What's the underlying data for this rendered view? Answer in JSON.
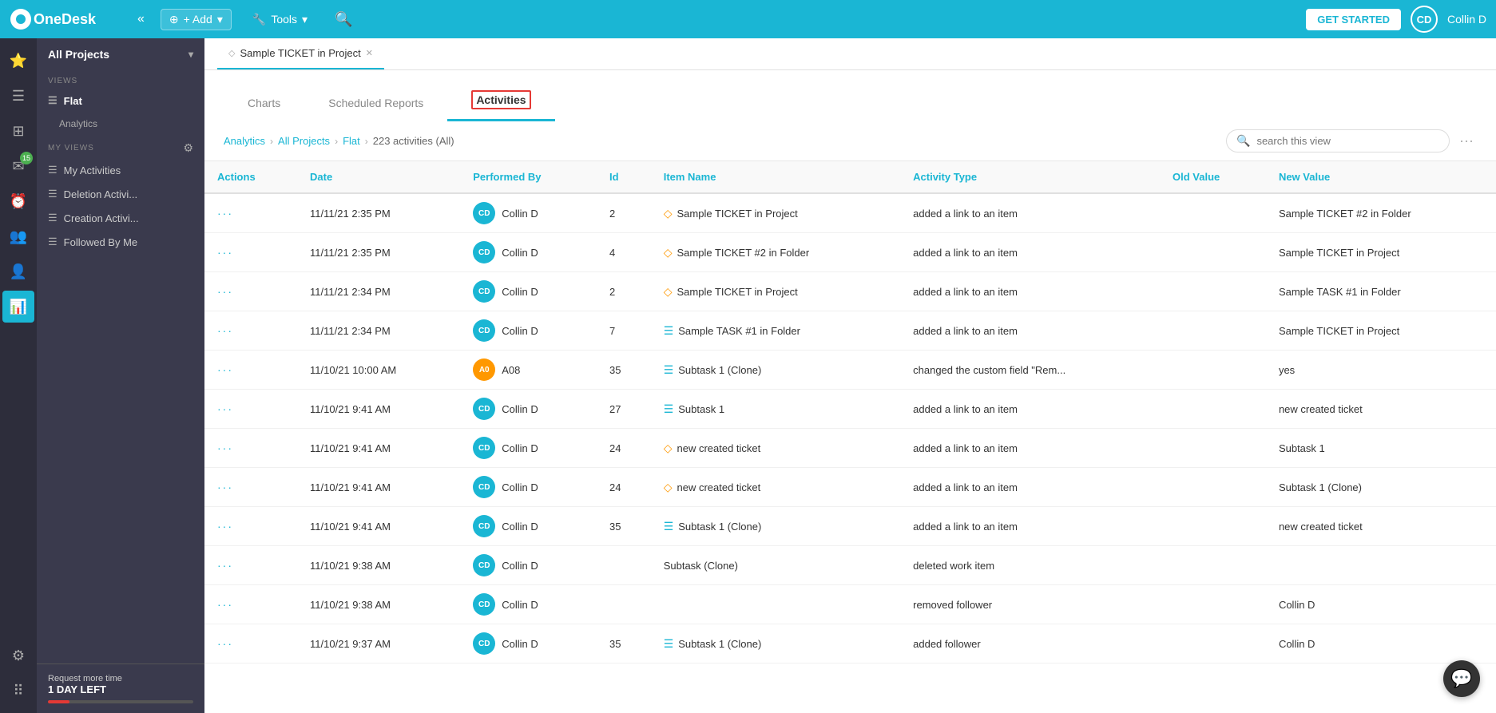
{
  "topbar": {
    "logo": "OneDesk",
    "collapse_btn": "«",
    "add_label": "+ Add",
    "add_dropdown": "▾",
    "tools_label": "Tools",
    "tools_dropdown": "▾",
    "get_started_label": "GET STARTED",
    "user_initials": "CD",
    "user_name": "Collin D"
  },
  "tab_bar": {
    "tabs": [
      {
        "label": "Sample TICKET in Project",
        "icon": "◇",
        "active": true,
        "closable": true
      }
    ]
  },
  "inner_tabs": {
    "tabs": [
      {
        "label": "Charts",
        "active": false
      },
      {
        "label": "Scheduled Reports",
        "active": false
      },
      {
        "label": "Activities",
        "active": true
      }
    ]
  },
  "breadcrumb": {
    "items": [
      "Analytics",
      "All Projects",
      "Flat"
    ],
    "current": "223 activities (All)"
  },
  "search": {
    "placeholder": "search this view"
  },
  "nav_sidebar": {
    "project_label": "All Projects",
    "views_label": "VIEWS",
    "flat_label": "Flat",
    "analytics_label": "Analytics",
    "my_views_label": "MY VIEWS",
    "my_views_items": [
      "My Activities",
      "Deletion Activi...",
      "Creation Activi...",
      "Followed By Me"
    ],
    "trial_label": "Request more time",
    "trial_days": "1 DAY LEFT"
  },
  "icon_sidebar": {
    "items": [
      {
        "icon": "★",
        "name": "favorites-icon",
        "active": false
      },
      {
        "icon": "☰",
        "name": "list-icon",
        "active": false
      },
      {
        "icon": "◻",
        "name": "board-icon",
        "active": false
      },
      {
        "icon": "✉",
        "name": "messages-icon",
        "active": false,
        "badge": "15"
      },
      {
        "icon": "⏰",
        "name": "timers-icon",
        "active": false
      },
      {
        "icon": "👥",
        "name": "users-icon",
        "active": false
      },
      {
        "icon": "👤",
        "name": "customers-icon",
        "active": false
      },
      {
        "icon": "📊",
        "name": "analytics-icon",
        "active": true
      }
    ],
    "bottom_items": [
      {
        "icon": "⚙",
        "name": "settings-icon",
        "active": false
      },
      {
        "icon": "⠿",
        "name": "apps-icon",
        "active": false
      }
    ]
  },
  "table": {
    "columns": [
      "Actions",
      "Date",
      "Performed By",
      "Id",
      "Item Name",
      "Activity Type",
      "Old Value",
      "New Value"
    ],
    "rows": [
      {
        "actions": "···",
        "date": "11/11/21 2:35 PM",
        "performed_by": "Collin D",
        "performed_by_initials": "CD",
        "performed_by_color": "blue",
        "id": "2",
        "item_name": "Sample TICKET in Project",
        "item_type": "ticket",
        "activity_type": "added a link to an item",
        "old_value": "",
        "new_value": "Sample TICKET #2 in Folder"
      },
      {
        "actions": "···",
        "date": "11/11/21 2:35 PM",
        "performed_by": "Collin D",
        "performed_by_initials": "CD",
        "performed_by_color": "blue",
        "id": "4",
        "item_name": "Sample TICKET #2 in Folder",
        "item_type": "ticket",
        "activity_type": "added a link to an item",
        "old_value": "",
        "new_value": "Sample TICKET in Project"
      },
      {
        "actions": "···",
        "date": "11/11/21 2:34 PM",
        "performed_by": "Collin D",
        "performed_by_initials": "CD",
        "performed_by_color": "blue",
        "id": "2",
        "item_name": "Sample TICKET in Project",
        "item_type": "ticket",
        "activity_type": "added a link to an item",
        "old_value": "",
        "new_value": "Sample TASK #1 in Folder"
      },
      {
        "actions": "···",
        "date": "11/11/21 2:34 PM",
        "performed_by": "Collin D",
        "performed_by_initials": "CD",
        "performed_by_color": "blue",
        "id": "7",
        "item_name": "Sample TASK #1 in Folder",
        "item_type": "task",
        "activity_type": "added a link to an item",
        "old_value": "",
        "new_value": "Sample TICKET in Project"
      },
      {
        "actions": "···",
        "date": "11/10/21 10:00 AM",
        "performed_by": "A08",
        "performed_by_initials": "A0",
        "performed_by_color": "orange",
        "id": "35",
        "item_name": "Subtask 1 (Clone)",
        "item_type": "task",
        "activity_type": "changed the custom field \"Rem...",
        "old_value": "",
        "new_value": "yes"
      },
      {
        "actions": "···",
        "date": "11/10/21 9:41 AM",
        "performed_by": "Collin D",
        "performed_by_initials": "CD",
        "performed_by_color": "blue",
        "id": "27",
        "item_name": "Subtask 1",
        "item_type": "task",
        "activity_type": "added a link to an item",
        "old_value": "",
        "new_value": "new created ticket"
      },
      {
        "actions": "···",
        "date": "11/10/21 9:41 AM",
        "performed_by": "Collin D",
        "performed_by_initials": "CD",
        "performed_by_color": "blue",
        "id": "24",
        "item_name": "new created ticket",
        "item_type": "ticket",
        "activity_type": "added a link to an item",
        "old_value": "",
        "new_value": "Subtask 1"
      },
      {
        "actions": "···",
        "date": "11/10/21 9:41 AM",
        "performed_by": "Collin D",
        "performed_by_initials": "CD",
        "performed_by_color": "blue",
        "id": "24",
        "item_name": "new created ticket",
        "item_type": "ticket",
        "activity_type": "added a link to an item",
        "old_value": "",
        "new_value": "Subtask 1 (Clone)"
      },
      {
        "actions": "···",
        "date": "11/10/21 9:41 AM",
        "performed_by": "Collin D",
        "performed_by_initials": "CD",
        "performed_by_color": "blue",
        "id": "35",
        "item_name": "Subtask 1 (Clone)",
        "item_type": "task",
        "activity_type": "added a link to an item",
        "old_value": "",
        "new_value": "new created ticket"
      },
      {
        "actions": "···",
        "date": "11/10/21 9:38 AM",
        "performed_by": "Collin D",
        "performed_by_initials": "CD",
        "performed_by_color": "blue",
        "id": "",
        "item_name": "Subtask (Clone)",
        "item_type": "none",
        "activity_type": "deleted work item",
        "old_value": "",
        "new_value": ""
      },
      {
        "actions": "···",
        "date": "11/10/21 9:38 AM",
        "performed_by": "Collin D",
        "performed_by_initials": "CD",
        "performed_by_color": "blue",
        "id": "",
        "item_name": "",
        "item_type": "none",
        "activity_type": "removed follower",
        "old_value": "",
        "new_value": "Collin D"
      },
      {
        "actions": "···",
        "date": "11/10/21 9:37 AM",
        "performed_by": "Collin D",
        "performed_by_initials": "CD",
        "performed_by_color": "blue",
        "id": "35",
        "item_name": "Subtask 1 (Clone)",
        "item_type": "task",
        "activity_type": "added follower",
        "old_value": "",
        "new_value": "Collin D"
      }
    ]
  }
}
